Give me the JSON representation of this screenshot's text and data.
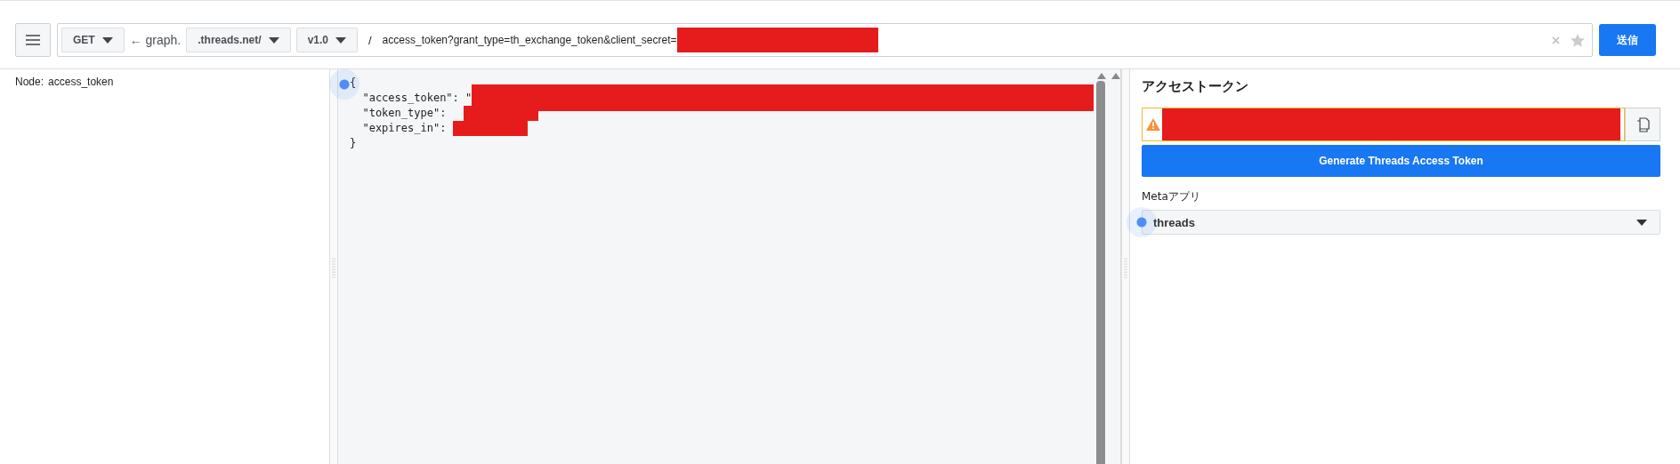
{
  "toolbar": {
    "method": "GET",
    "host_prefix": "← graph.",
    "host": ".threads.net/",
    "version": "v1.0",
    "separator": "/",
    "path": "access_token?grant_type=th_exchange_token&client_secret=",
    "submit": "送信"
  },
  "node": {
    "label": "Node:",
    "value": "access_token"
  },
  "response": {
    "lines": [
      "{",
      "  \"access_token\": \"",
      "  \"token_type\": ",
      "  \"expires_in\": ",
      "}"
    ]
  },
  "token_panel": {
    "title": "アクセストークン",
    "warning": true,
    "generate_button": "Generate Threads Access Token",
    "app_label": "Metaアプリ",
    "app_value": "threads"
  }
}
